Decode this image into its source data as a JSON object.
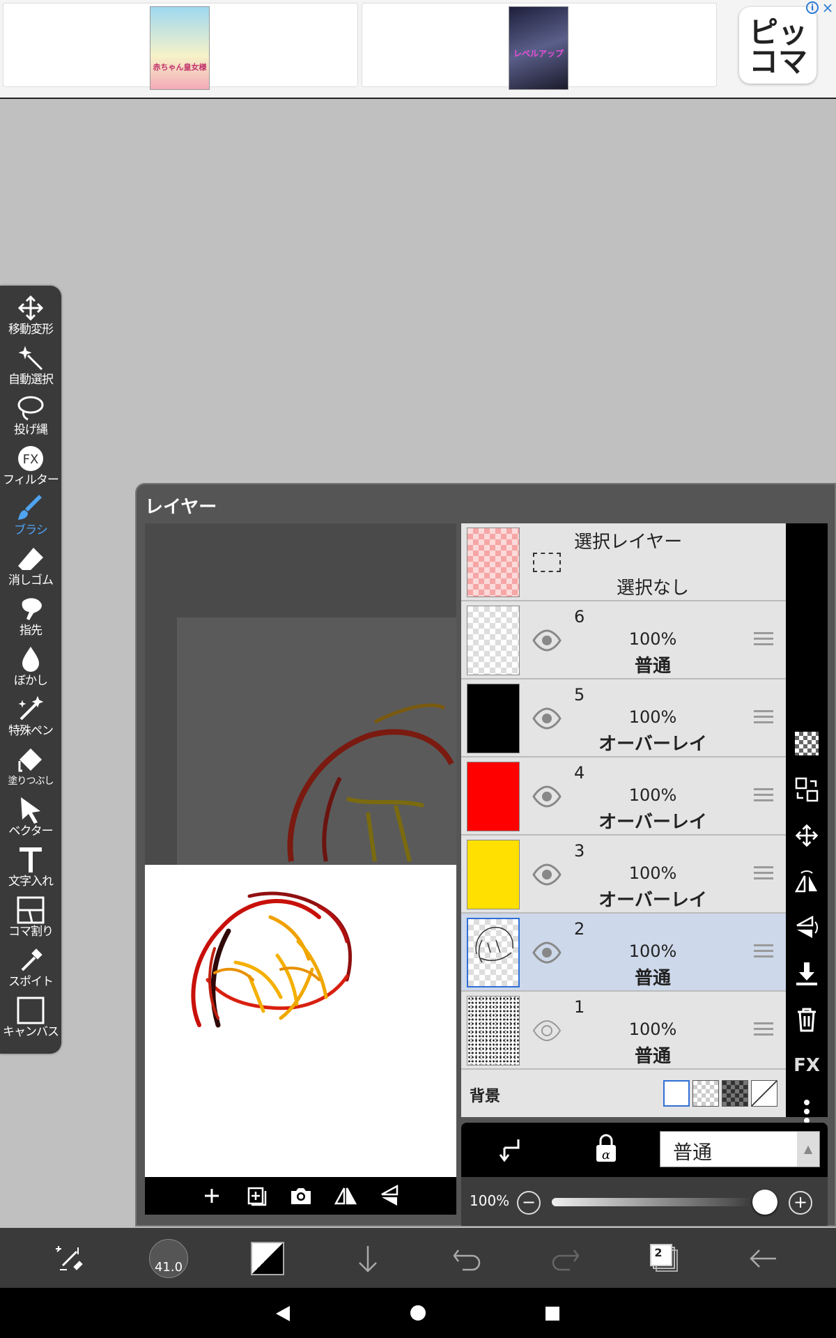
{
  "ad": {
    "logo_line1": "ピッ",
    "logo_line2": "コマ",
    "info": "i",
    "close": "×",
    "book1_title": "赤ちゃん皇女様",
    "book2_title": "レベルアップ"
  },
  "toolbar": {
    "items": [
      {
        "label": "移動変形",
        "icon": "move-icon"
      },
      {
        "label": "自動選択",
        "icon": "magic-wand-icon"
      },
      {
        "label": "投げ縄",
        "icon": "lasso-icon"
      },
      {
        "label": "フィルター",
        "icon": "fx-icon"
      },
      {
        "label": "ブラシ",
        "icon": "brush-icon"
      },
      {
        "label": "消しゴム",
        "icon": "eraser-icon"
      },
      {
        "label": "指先",
        "icon": "finger-icon"
      },
      {
        "label": "ぼかし",
        "icon": "blur-drop-icon"
      },
      {
        "label": "特殊ペン",
        "icon": "special-pen-icon"
      },
      {
        "label": "塗りつぶし",
        "icon": "fill-bucket-icon"
      },
      {
        "label": "ベクター",
        "icon": "vector-arrow-icon"
      },
      {
        "label": "文字入れ",
        "icon": "text-icon"
      },
      {
        "label": "コマ割り",
        "icon": "panel-split-icon"
      },
      {
        "label": "スポイト",
        "icon": "eyedropper-icon"
      },
      {
        "label": "キャンバス",
        "icon": "canvas-icon"
      }
    ],
    "active": "ブラシ",
    "active_color": "#4fa3f0"
  },
  "layer_panel": {
    "title": "レイヤー",
    "selection_layer": {
      "title": "選択レイヤー",
      "status": "選択なし"
    },
    "layers": [
      {
        "number": "6",
        "opacity": "100%",
        "mode": "普通",
        "thumb": "transparent",
        "selected": false
      },
      {
        "number": "5",
        "opacity": "100%",
        "mode": "オーバーレイ",
        "thumb": "#000000",
        "selected": false
      },
      {
        "number": "4",
        "opacity": "100%",
        "mode": "オーバーレイ",
        "thumb": "#ff0000",
        "selected": false
      },
      {
        "number": "3",
        "opacity": "100%",
        "mode": "オーバーレイ",
        "thumb": "#ffe000",
        "selected": false
      },
      {
        "number": "2",
        "opacity": "100%",
        "mode": "普通",
        "thumb": "sketch",
        "selected": true
      },
      {
        "number": "1",
        "opacity": "100%",
        "mode": "普通",
        "thumb": "noise",
        "selected": false
      }
    ],
    "background_label": "背景",
    "blend_mode": "普通",
    "blend_arrow": "▲",
    "opacity": "100%",
    "minus": "−",
    "plus": "+",
    "side_fx_label": "FX"
  },
  "bottom_bar": {
    "brush_size": "41.0",
    "layer_count": "2"
  }
}
